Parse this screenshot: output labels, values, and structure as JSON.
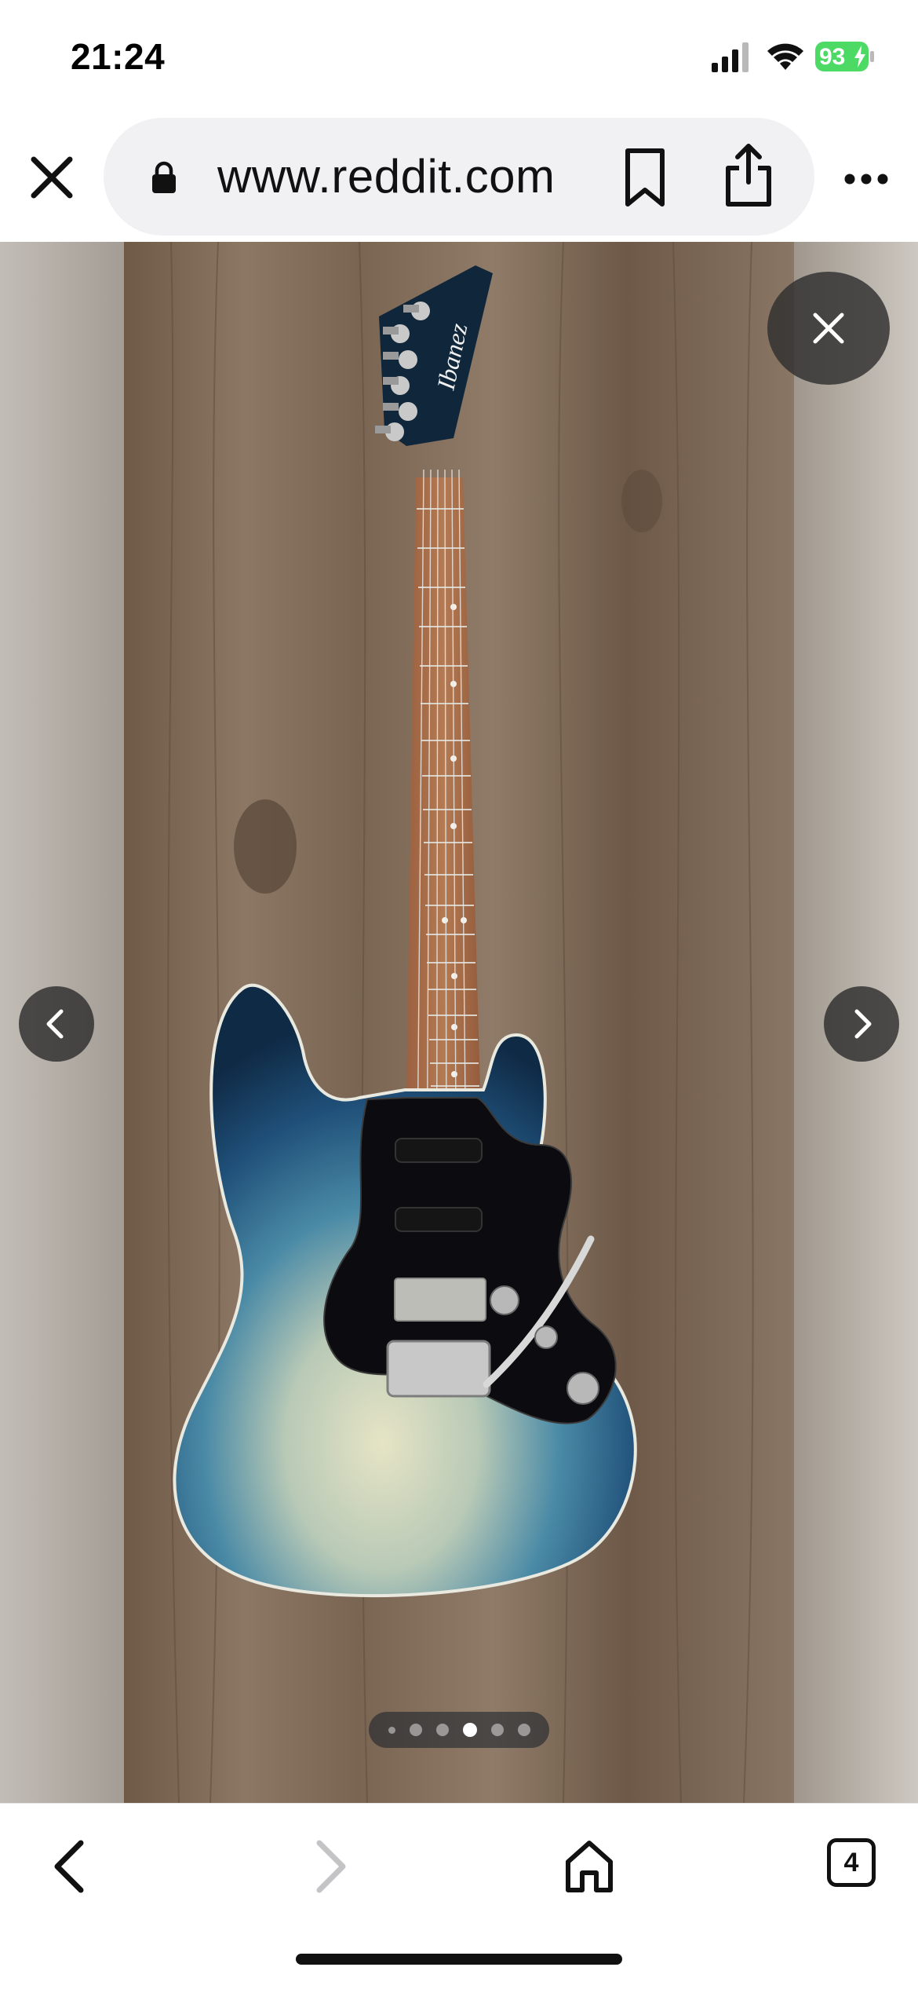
{
  "status_bar": {
    "time": "21:24",
    "battery_percent": "93",
    "battery_charging": true,
    "battery_color": "#4cd964",
    "icons": [
      "signal-icon",
      "wifi-icon",
      "battery-icon"
    ]
  },
  "browser": {
    "url": "www.reddit.com",
    "icons": [
      "close-icon",
      "lock-icon",
      "bookmark-icon",
      "share-icon",
      "more-icon"
    ]
  },
  "viewer": {
    "image_count": 6,
    "active_index": 3,
    "icons": [
      "close-icon",
      "chevron-left-icon",
      "chevron-right-icon"
    ]
  },
  "toolbar": {
    "tabs_count": "4",
    "icons": [
      "back-icon",
      "forward-icon",
      "home-icon",
      "tabs-icon"
    ],
    "forward_enabled": false
  }
}
